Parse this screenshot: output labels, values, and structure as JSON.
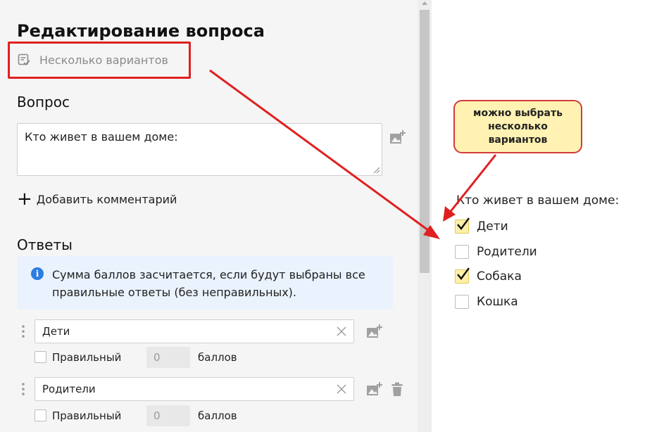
{
  "editor": {
    "title": "Редактирование вопроса",
    "question_type": {
      "label": "Несколько вариантов",
      "icon": "multiple-choice-icon"
    },
    "question_section": "Вопрос",
    "question_text": "Кто живет в вашем доме:",
    "add_comment": "Добавить комментарий",
    "answers_section": "Ответы",
    "info": "Сумма баллов засчитается, если будут выбраны все правильные ответы (без неправильных).",
    "answers": [
      {
        "text": "Дети",
        "correct_label": "Правильный",
        "points": "0",
        "points_label": "баллов",
        "correct": false
      },
      {
        "text": "Родители",
        "correct_label": "Правильный",
        "points": "0",
        "points_label": "баллов",
        "correct": false
      }
    ]
  },
  "callout": {
    "lines": [
      "можно выбрать",
      "несколько",
      "вариантов"
    ]
  },
  "preview": {
    "question": "Кто живет в вашем доме:",
    "options": [
      {
        "label": "Дети",
        "checked": true
      },
      {
        "label": "Родители",
        "checked": false
      },
      {
        "label": "Собака",
        "checked": true
      },
      {
        "label": "Кошка",
        "checked": false
      }
    ]
  },
  "colors": {
    "annotation_red": "#e02020",
    "info_blue": "#2a7de1",
    "callout_fill": "#fff2b3",
    "checked_fill": "#fff0a8"
  }
}
